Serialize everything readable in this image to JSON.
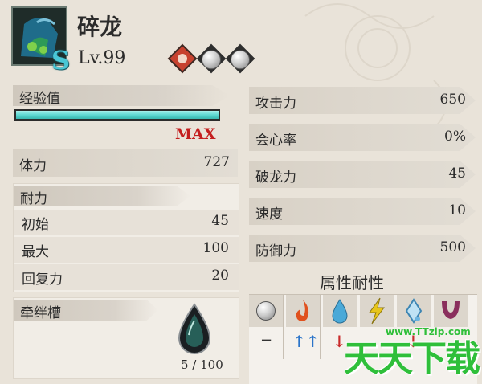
{
  "monster": {
    "name": "碎龙",
    "rank": "S",
    "level": "Lv.99"
  },
  "experience": {
    "label": "经验值",
    "fill_fraction": 1.0,
    "status": "MAX"
  },
  "stamina": {
    "label": "体力",
    "value": "727"
  },
  "endurance": {
    "label": "耐力",
    "rows": [
      {
        "label": "初始",
        "value": "45"
      },
      {
        "label": "最大",
        "value": "100"
      },
      {
        "label": "回复力",
        "value": "20"
      }
    ]
  },
  "bond": {
    "label": "牵绊槽",
    "value": "5 / 100"
  },
  "stats": [
    {
      "label": "攻击力",
      "value": "650"
    },
    {
      "label": "会心率",
      "value": "0%"
    },
    {
      "label": "破龙力",
      "value": "45"
    },
    {
      "label": "速度",
      "value": "10"
    },
    {
      "label": "防御力",
      "value": "500"
    }
  ],
  "resist": {
    "title": "属性耐性",
    "elements": [
      {
        "icon": "none-element-icon",
        "mark": "−"
      },
      {
        "icon": "fire-element-icon",
        "mark": "↑↑"
      },
      {
        "icon": "water-element-icon",
        "mark": "↓"
      },
      {
        "icon": "thunder-element-icon",
        "mark": ""
      },
      {
        "icon": "ice-element-icon",
        "mark": "↓"
      },
      {
        "icon": "dragon-element-icon",
        "mark": ""
      }
    ]
  },
  "watermark": {
    "text": "天天下载",
    "url": "www.TTzip.com"
  },
  "colors": {
    "exp_bar": "#5fd8d2",
    "max_text": "#c41f1f",
    "fire": "#e0511e",
    "water": "#4aa9d8",
    "thunder": "#e7c51a",
    "ice": "#6bb4e0",
    "dragon": "#8a2f5d",
    "up_arrow": "#2a74c9",
    "down_arrow": "#c92a2a",
    "watermark_green": "#2fbf3a"
  }
}
